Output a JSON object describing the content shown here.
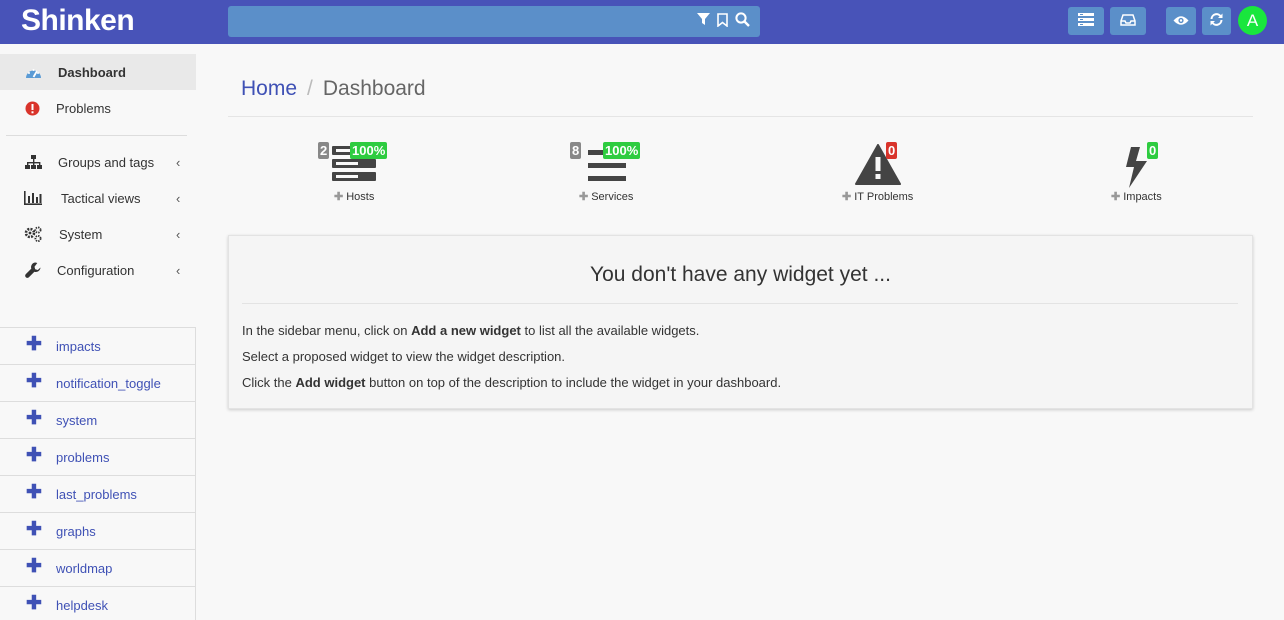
{
  "header": {
    "brand": "Shinken",
    "avatar_letter": "A",
    "search_icons": [
      "filter-icon",
      "bookmark-icon",
      "search-icon"
    ],
    "buttons": [
      "list-icon",
      "inbox-icon",
      "eye-icon",
      "refresh-icon"
    ],
    "colors": {
      "bar": "#4853b8",
      "search": "#5b8fc9",
      "avatar": "#19e63d"
    }
  },
  "sidebar": {
    "nav": [
      {
        "label": "Dashboard",
        "icon": "dashboard-icon",
        "active": true
      },
      {
        "label": "Problems",
        "icon": "exclamation-circle-icon"
      },
      {
        "label": "Groups and tags",
        "icon": "sitemap-icon",
        "chevron": "‹"
      },
      {
        "label": "Tactical views",
        "icon": "bar-chart-icon",
        "chevron": "‹"
      },
      {
        "label": "System",
        "icon": "gears-icon",
        "chevron": "‹"
      },
      {
        "label": "Configuration",
        "icon": "wrench-icon",
        "chevron": "‹"
      }
    ],
    "widgets": [
      {
        "label": "impacts"
      },
      {
        "label": "notification_toggle"
      },
      {
        "label": "system"
      },
      {
        "label": "problems"
      },
      {
        "label": "last_problems"
      },
      {
        "label": "graphs"
      },
      {
        "label": "worldmap"
      },
      {
        "label": "helpdesk"
      }
    ],
    "widget_plus": "✚"
  },
  "breadcrumb": {
    "home": "Home",
    "separator": "/",
    "current": "Dashboard"
  },
  "stats": {
    "plus": "✚",
    "hosts": {
      "label": "Hosts",
      "count": "2",
      "percent": "100%"
    },
    "services": {
      "label": "Services",
      "count": "8",
      "percent": "100%"
    },
    "it_problems": {
      "label": "IT Problems",
      "count": "0"
    },
    "impacts": {
      "label": "Impacts",
      "count": "0"
    }
  },
  "panel": {
    "title": "You don't have any widget yet ...",
    "line1": {
      "pre": "In the sidebar menu, click on ",
      "bold": "Add a new widget",
      "post": " to list all the available widgets."
    },
    "line2": "Select a proposed widget to view the widget description.",
    "line3": {
      "pre": "Click the ",
      "bold": "Add widget",
      "post": " button on top of the description to include the widget in your dashboard."
    }
  }
}
